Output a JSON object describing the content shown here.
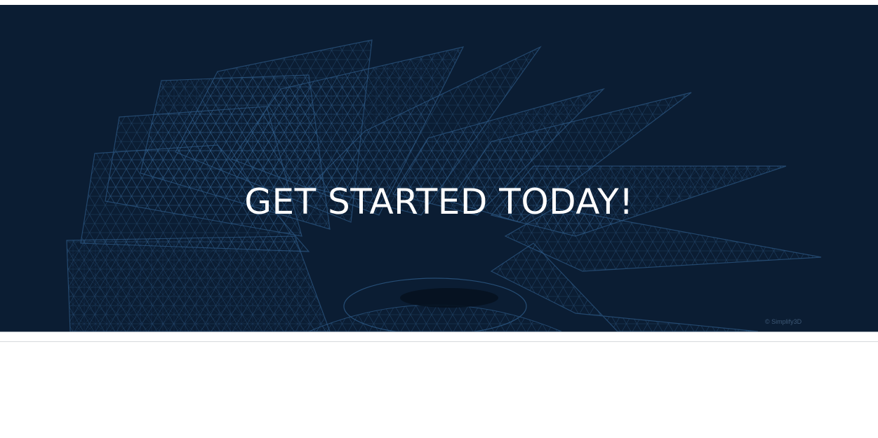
{
  "hero": {
    "title": "GET STARTED TODAY!",
    "watermark": "© Simplify3D",
    "background_color": "#0b1d33",
    "mesh_color": "#2d5a86",
    "title_color": "#ffffff",
    "art": "turbine-mesh-image"
  },
  "divider": {
    "color": "#9aa3ad"
  }
}
